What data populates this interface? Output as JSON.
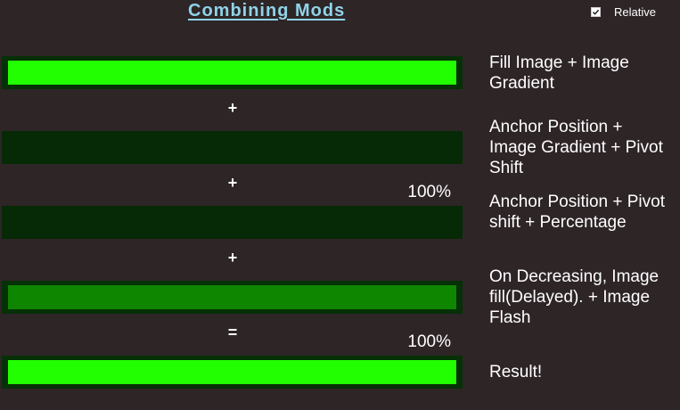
{
  "header": {
    "title": "Combining Mods",
    "relative_label": "Relative",
    "relative_checked": true
  },
  "colors": {
    "background": "#2e2527",
    "title": "#8fd3e8",
    "bar_bright": "#22ff00",
    "bar_dark": "#052a05",
    "bar_medium": "#0f8600",
    "bar_border": "#063006"
  },
  "bars": [
    {
      "fill_fraction": 1.0,
      "style": "bright"
    },
    {
      "fill_fraction": 0.0,
      "style": "dark"
    },
    {
      "fill_fraction": 0.0,
      "style": "dark"
    },
    {
      "fill_fraction": 1.0,
      "style": "medium"
    },
    {
      "fill_fraction": 1.0,
      "style": "bright"
    }
  ],
  "operators": [
    "+",
    "+",
    "+",
    "="
  ],
  "percentages": [
    "100%",
    "100%"
  ],
  "descriptions": [
    "Fill Image + Image Gradient",
    "Anchor Position + Image Gradient + Pivot Shift",
    "Anchor Position + Pivot shift + Percentage",
    "On Decreasing, Image fill(Delayed). + Image Flash",
    "Result!"
  ]
}
